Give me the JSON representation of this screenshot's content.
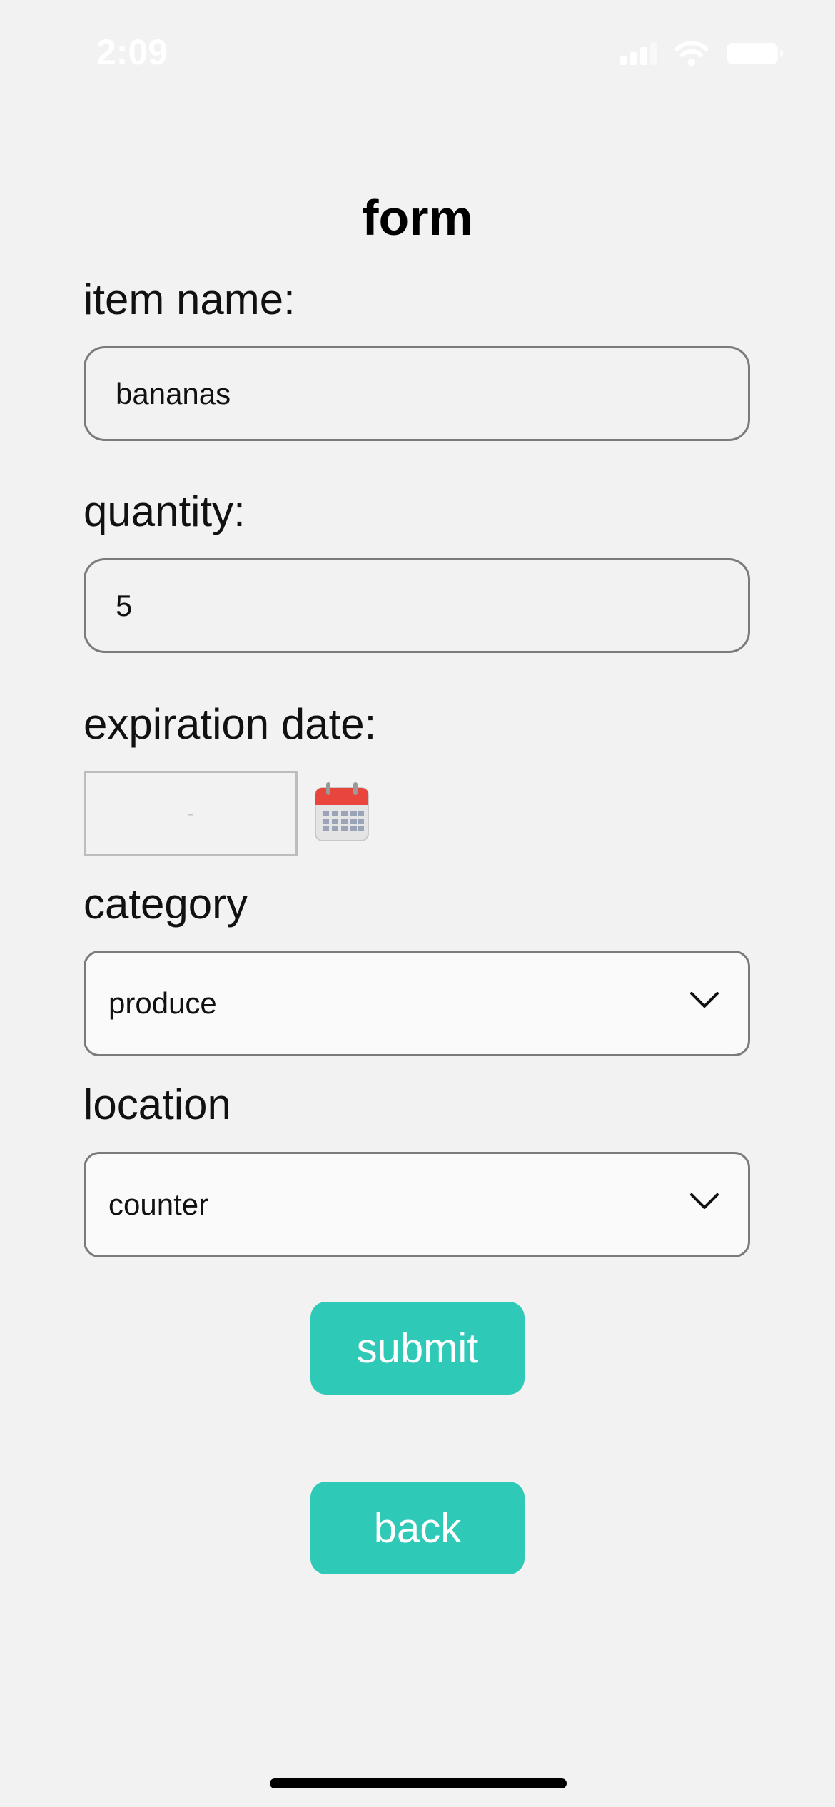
{
  "status_bar": {
    "time": "2:09",
    "icons": [
      "signal-icon",
      "wifi-icon",
      "battery-icon"
    ]
  },
  "form": {
    "title": "form",
    "item_name": {
      "label": "item name:",
      "value": "bananas"
    },
    "quantity": {
      "label": "quantity:",
      "value": "5"
    },
    "expiration_date": {
      "label": "expiration date:",
      "value": "-",
      "icon": "calendar-icon"
    },
    "category": {
      "label": "category",
      "selected": "produce",
      "icon": "chevron-down-icon"
    },
    "location": {
      "label": "location",
      "selected": "counter",
      "icon": "chevron-down-icon"
    },
    "submit_label": "submit",
    "back_label": "back"
  },
  "colors": {
    "background": "#f2f2f2",
    "button": "#2ec9b7",
    "button_text": "#ffffff",
    "field_border": "#7b7b7b",
    "calendar_red": "#e8453c"
  }
}
